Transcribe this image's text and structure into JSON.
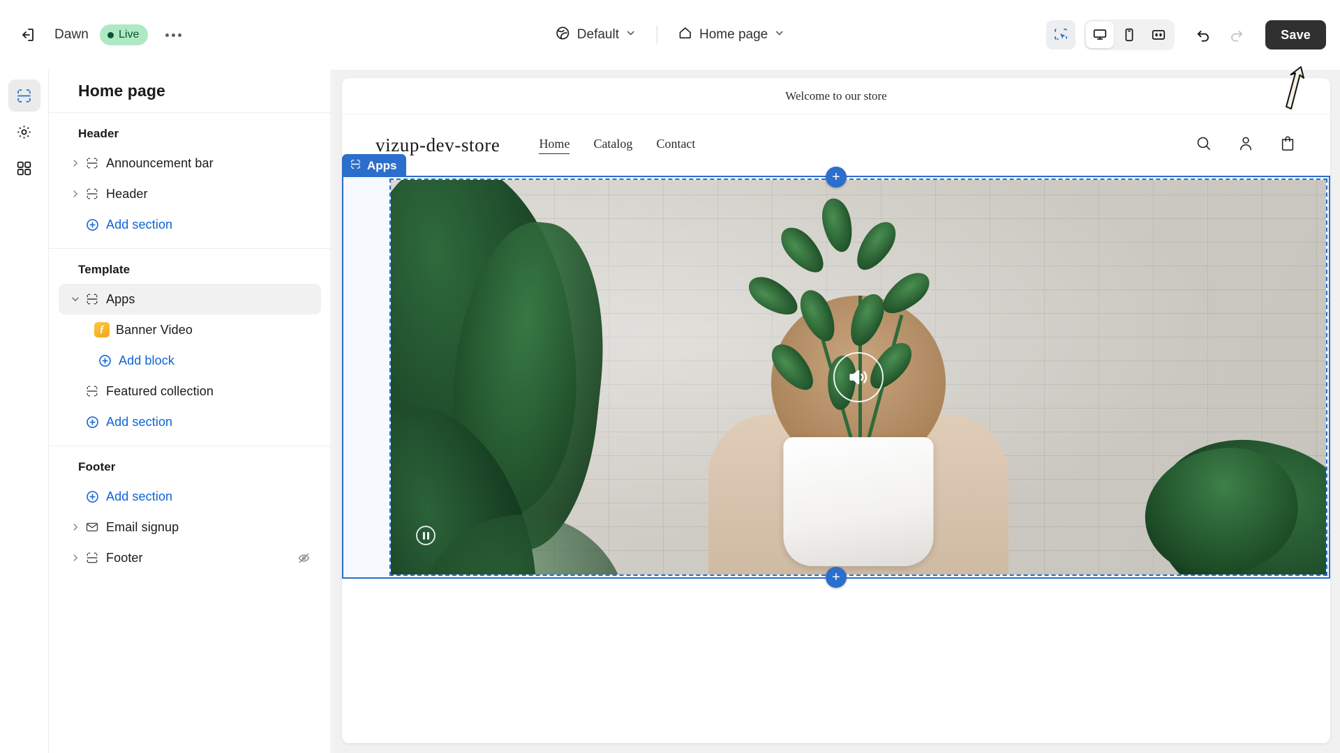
{
  "topbar": {
    "exit_icon": "exit-icon",
    "theme_name": "Dawn",
    "status_badge": "Live",
    "more_label": "…",
    "locale_icon": "globe-icon",
    "locale_label": "Default",
    "page_icon": "home-icon",
    "page_label": "Home page",
    "tools": [
      {
        "name": "inspect-select-tool",
        "icon": "select-cursor-icon",
        "active": true
      }
    ],
    "devices": [
      {
        "name": "desktop",
        "icon": "desktop-icon",
        "selected": true
      },
      {
        "name": "mobile",
        "icon": "mobile-icon",
        "selected": false
      },
      {
        "name": "fullscreen",
        "icon": "fullscreen-icon",
        "selected": false
      }
    ],
    "undo_icon": "undo-icon",
    "redo_icon": "redo-icon",
    "save_label": "Save",
    "accent_blue": "#2c6ecb",
    "save_bg": "#303030",
    "live_bg": "#aee9c3",
    "live_fg": "#0c5132"
  },
  "rail": {
    "items": [
      {
        "name": "sections",
        "icon": "sections-icon",
        "selected": true
      },
      {
        "name": "theme-settings",
        "icon": "gear-icon",
        "selected": false
      },
      {
        "name": "apps",
        "icon": "apps-grid-icon",
        "selected": false
      }
    ]
  },
  "sidebar": {
    "title": "Home page",
    "groups": [
      {
        "title": "Header",
        "rows": [
          {
            "label": "Announcement bar",
            "icon": "section-icon",
            "caret": "right",
            "type": "section"
          },
          {
            "label": "Header",
            "icon": "section-icon",
            "caret": "right",
            "type": "section"
          },
          {
            "label": "Add section",
            "icon": "plus-circle-icon",
            "type": "link"
          }
        ]
      },
      {
        "title": "Template",
        "rows": [
          {
            "label": "Apps",
            "icon": "section-icon",
            "caret": "down",
            "type": "section",
            "selected": true
          },
          {
            "label": "Banner Video",
            "icon": "app-badge-icon",
            "type": "block"
          },
          {
            "label": "Add block",
            "icon": "plus-circle-icon",
            "type": "link",
            "indent": true
          },
          {
            "label": "Featured collection",
            "icon": "section-icon",
            "type": "section",
            "nocaret": true
          },
          {
            "label": "Add section",
            "icon": "plus-circle-icon",
            "type": "link"
          }
        ]
      },
      {
        "title": "Footer",
        "rows": [
          {
            "label": "Add section",
            "icon": "plus-circle-icon",
            "type": "link"
          },
          {
            "label": "Email signup",
            "icon": "envelope-icon",
            "caret": "right",
            "type": "section"
          },
          {
            "label": "Footer",
            "icon": "footer-section-icon",
            "caret": "right",
            "type": "section",
            "hidden_icon": "eye-off-icon"
          }
        ]
      }
    ]
  },
  "preview": {
    "announcement": "Welcome to our store",
    "store_logo": "vizup-dev-store",
    "nav": [
      {
        "label": "Home",
        "current": true
      },
      {
        "label": "Catalog",
        "current": false
      },
      {
        "label": "Contact",
        "current": false
      }
    ],
    "actions": [
      {
        "name": "search-icon"
      },
      {
        "name": "account-icon"
      },
      {
        "name": "cart-icon"
      }
    ],
    "selection": {
      "badge_label": "Apps",
      "badge_icon": "section-icon",
      "add_above_label": "+",
      "add_below_label": "+"
    },
    "video": {
      "sound_icon": "speaker-on-icon",
      "pause_icon": "pause-icon"
    }
  }
}
